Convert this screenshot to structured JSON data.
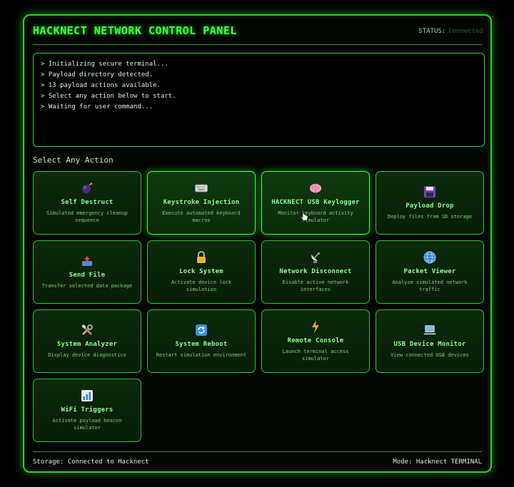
{
  "header": {
    "title": "HACKNECT NETWORK CONTROL PANEL",
    "status_label": "STATUS:",
    "status_value": "Connected"
  },
  "terminal": {
    "lines": [
      "> Initializing secure terminal...",
      "> Payload directory detected.",
      "> 13 payload actions available.",
      "> Select any action below to start.",
      "> Waiting for user command..."
    ]
  },
  "actions": {
    "section_label": "Select Any Action",
    "items": [
      {
        "title": "Self Destruct",
        "desc": "Simulated emergency cleanup sequence",
        "icon": "bomb-icon"
      },
      {
        "title": "Keystroke Injection",
        "desc": "Execute automated keyboard macros",
        "icon": "keyboard-icon"
      },
      {
        "title": "HACKNECT USB Keylogger",
        "desc": "Monitor keyboard activity simulator",
        "icon": "brain-icon"
      },
      {
        "title": "Payload Drop",
        "desc": "Deploy files from SD storage",
        "icon": "floppy-disk-icon"
      },
      {
        "title": "Send File",
        "desc": "Transfer selected data package",
        "icon": "outbox-tray-icon"
      },
      {
        "title": "Lock System",
        "desc": "Activate device lock simulation",
        "icon": "lock-icon"
      },
      {
        "title": "Network Disconnect",
        "desc": "Disable active network interfaces",
        "icon": "satellite-dish-icon"
      },
      {
        "title": "Packet Viewer",
        "desc": "Analyze simulated network traffic",
        "icon": "globe-icon"
      },
      {
        "title": "System Analyzer",
        "desc": "Display device diagnostics",
        "icon": "tools-icon"
      },
      {
        "title": "System Reboot",
        "desc": "Restart simulation environment",
        "icon": "refresh-icon"
      },
      {
        "title": "Remote Console",
        "desc": "Launch terminal access simulator",
        "icon": "lightning-icon"
      },
      {
        "title": "USB Device Monitor",
        "desc": "View connected USB devices",
        "icon": "laptop-icon"
      },
      {
        "title": "WiFi Triggers",
        "desc": "Activate payload beacon simulator",
        "icon": "bar-chart-icon"
      }
    ]
  },
  "footer": {
    "storage": "Storage: Connected to Hacknect",
    "mode": "Mode: Hacknect TERMINAL"
  }
}
